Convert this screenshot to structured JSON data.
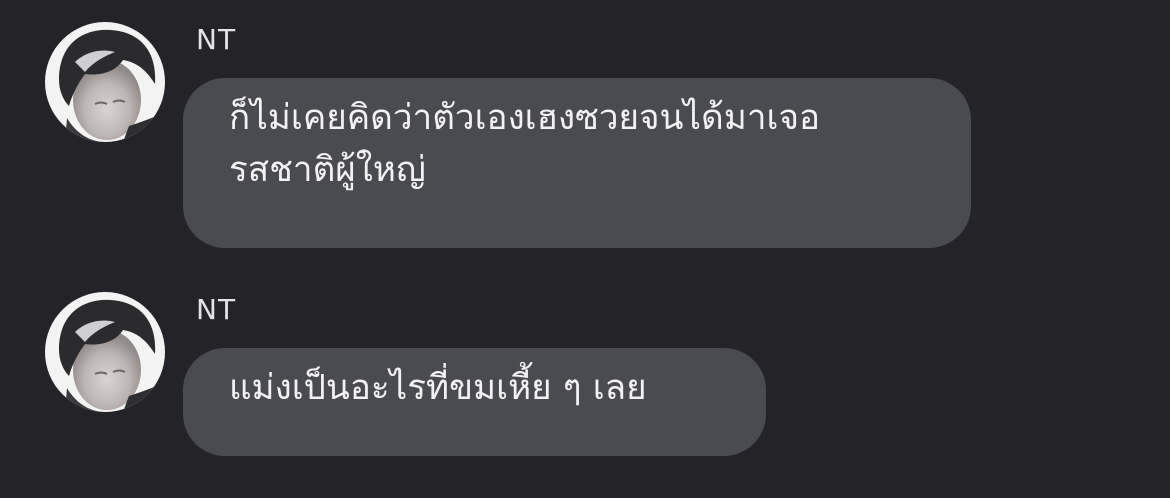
{
  "colors": {
    "background": "#232328",
    "bubble": "#4a4b50",
    "text": "#f2f2f4",
    "sender": "#e4e4e8"
  },
  "messages": [
    {
      "sender": "NT",
      "avatar": "avatar-photo",
      "text": "ก็ไม่เคยคิดว่าตัวเองเฮงซวยจนได้มาเจอ\nรสชาติผู้ใหญ่"
    },
    {
      "sender": "NT",
      "avatar": "avatar-photo",
      "text": "แม่งเป็นอะไรที่ขมเหี้ย ๆ เลย"
    }
  ]
}
